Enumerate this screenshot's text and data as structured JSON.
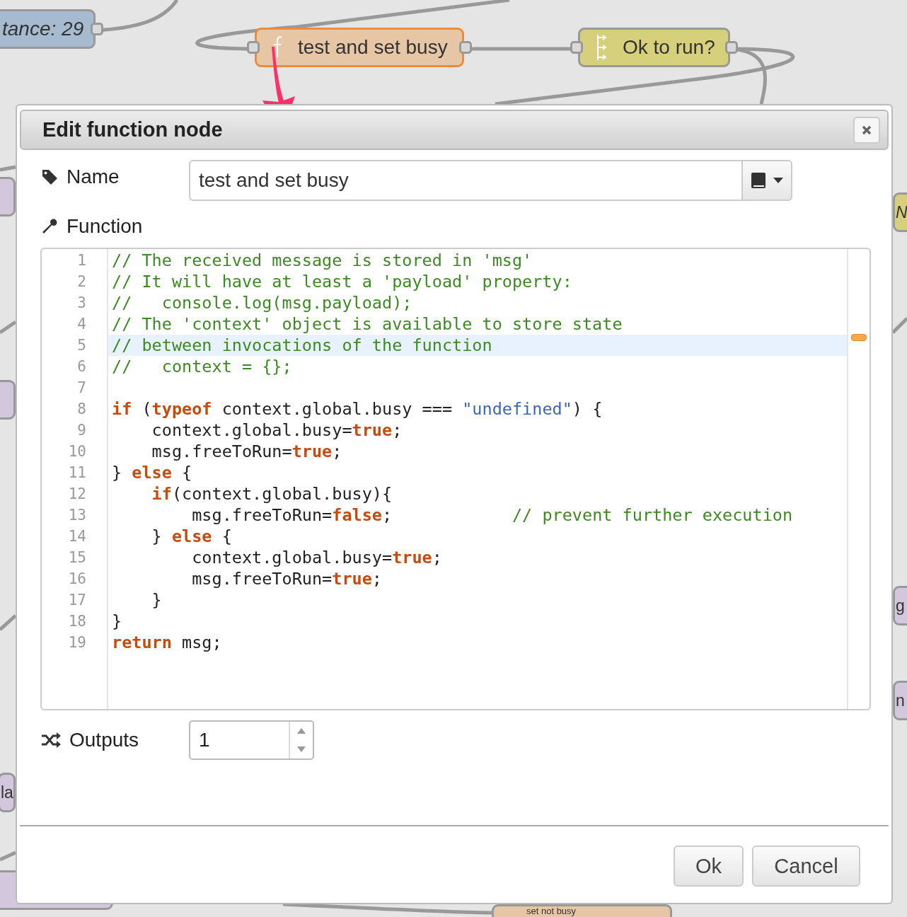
{
  "canvas": {
    "nodes": [
      {
        "label": "tance: 29",
        "color": "#a6bbcf",
        "selected": false,
        "italic": true
      },
      {
        "label": "test and set busy",
        "color": "#e7c6a5",
        "selected": true,
        "kind": "function"
      },
      {
        "label": "Ok to run?",
        "color": "#d6cf7c",
        "selected": false,
        "kind": "switch"
      },
      {
        "label": "N",
        "color": "#d6cf7c",
        "selected": false,
        "italic": true
      },
      {
        "color": "#d2c7dc",
        "selected": false
      },
      {
        "color": "#d2c7dc",
        "selected": false
      },
      {
        "label": "g",
        "color": "#d2c7dc",
        "selected": false
      },
      {
        "label": "n",
        "color": "#d2c7dc",
        "selected": false
      },
      {
        "label": "la",
        "color": "#d2c7dc",
        "selected": false
      },
      {
        "color": "#d2c7dc",
        "selected": false
      },
      {
        "label": "set not busy",
        "color": "#e7c6a5",
        "selected": false,
        "kind": "function"
      }
    ]
  },
  "dialog": {
    "title": "Edit function node",
    "name": {
      "label": "Name",
      "value": "test and set busy"
    },
    "function": {
      "label": "Function",
      "lines": [
        {
          "active": false,
          "tokens": [
            {
              "kind": "comment",
              "t": "// The received message is stored in 'msg'"
            }
          ]
        },
        {
          "active": false,
          "tokens": [
            {
              "kind": "comment",
              "t": "// It will have at least a 'payload' property:"
            }
          ]
        },
        {
          "active": false,
          "tokens": [
            {
              "kind": "comment",
              "t": "//   console.log(msg.payload);"
            }
          ]
        },
        {
          "active": false,
          "tokens": [
            {
              "kind": "comment",
              "t": "// The 'context' object is available to store state"
            }
          ]
        },
        {
          "active": true,
          "tokens": [
            {
              "kind": "comment",
              "t": "// between invocations of the function"
            }
          ]
        },
        {
          "active": false,
          "tokens": [
            {
              "kind": "comment",
              "t": "//   context = {};"
            }
          ]
        },
        {
          "active": false
        },
        {
          "active": false,
          "tokens": [
            {
              "kind": "keyword",
              "t": "if"
            },
            {
              "kind": "plain",
              "t": " ("
            },
            {
              "kind": "keyword",
              "t": "typeof"
            },
            {
              "kind": "plain",
              "t": " context.global.busy === "
            },
            {
              "kind": "string",
              "t": "\"undefined\""
            },
            {
              "kind": "plain",
              "t": ") {"
            }
          ]
        },
        {
          "active": false,
          "tokens": [
            {
              "kind": "plain",
              "t": "    context.global.busy="
            },
            {
              "kind": "keyword",
              "t": "true"
            },
            {
              "kind": "plain",
              "t": ";"
            }
          ]
        },
        {
          "active": false,
          "tokens": [
            {
              "kind": "plain",
              "t": "    msg.freeToRun="
            },
            {
              "kind": "keyword",
              "t": "true"
            },
            {
              "kind": "plain",
              "t": ";"
            }
          ]
        },
        {
          "active": false,
          "tokens": [
            {
              "kind": "plain",
              "t": "} "
            },
            {
              "kind": "keyword",
              "t": "else"
            },
            {
              "kind": "plain",
              "t": " {"
            }
          ]
        },
        {
          "active": false,
          "tokens": [
            {
              "kind": "keyword",
              "t": "    if"
            },
            {
              "kind": "plain",
              "t": "(context.global.busy){"
            }
          ]
        },
        {
          "active": false,
          "tokens": [
            {
              "kind": "plain",
              "t": "        msg.freeToRun="
            },
            {
              "kind": "keyword",
              "t": "false"
            },
            {
              "kind": "plain",
              "t": ";            "
            },
            {
              "kind": "comment",
              "t": "// prevent further execution"
            }
          ]
        },
        {
          "active": false,
          "tokens": [
            {
              "kind": "plain",
              "t": "    } "
            },
            {
              "kind": "keyword",
              "t": "else"
            },
            {
              "kind": "plain",
              "t": " {"
            }
          ]
        },
        {
          "active": false,
          "tokens": [
            {
              "kind": "plain",
              "t": "        context.global.busy="
            },
            {
              "kind": "keyword",
              "t": "true"
            },
            {
              "kind": "plain",
              "t": ";"
            }
          ]
        },
        {
          "active": false,
          "tokens": [
            {
              "kind": "plain",
              "t": "        msg.freeToRun="
            },
            {
              "kind": "keyword",
              "t": "true"
            },
            {
              "kind": "plain",
              "t": ";"
            }
          ]
        },
        {
          "active": false,
          "tokens": [
            {
              "kind": "plain",
              "t": "    }"
            }
          ]
        },
        {
          "active": false,
          "tokens": [
            {
              "kind": "plain",
              "t": "}"
            }
          ]
        },
        {
          "active": false,
          "tokens": [
            {
              "kind": "keyword",
              "t": "return"
            },
            {
              "kind": "plain",
              "t": " msg;"
            }
          ]
        }
      ],
      "line_numbers": [
        "1",
        "2",
        "3",
        "4",
        "5",
        "6",
        "7",
        "8",
        "9",
        "10",
        "11",
        "12",
        "13",
        "14",
        "15",
        "16",
        "17",
        "18",
        "19"
      ]
    },
    "outputs": {
      "label": "Outputs",
      "value": "1"
    },
    "buttons": [
      "Ok",
      "Cancel"
    ]
  }
}
